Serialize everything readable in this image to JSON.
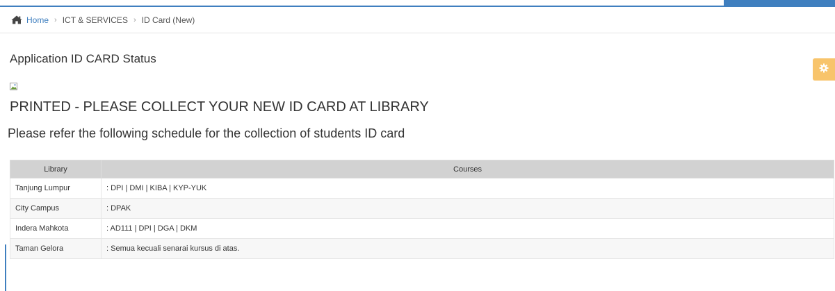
{
  "breadcrumb": {
    "home": "Home",
    "items": [
      "ICT & SERVICES",
      "ID Card (New)"
    ],
    "separator": "›"
  },
  "page": {
    "title": "Application ID CARD Status",
    "status": "PRINTED - PLEASE COLLECT YOUR NEW ID CARD AT LIBRARY",
    "schedule_note": "Please refer the following schedule for the collection of students ID card"
  },
  "table": {
    "headers": [
      "Library",
      "Courses"
    ],
    "rows": [
      {
        "library": "Tanjung Lumpur",
        "courses": ": DPI | DMI | KIBA | KYP-YUK"
      },
      {
        "library": "City Campus",
        "courses": ": DPAK"
      },
      {
        "library": "Indera Mahkota",
        "courses": ": AD111 | DPI | DGA | DKM"
      },
      {
        "library": "Taman Gelora",
        "courses": ": Semua kecuali senarai kursus di atas."
      }
    ]
  },
  "colors": {
    "accent": "#3f7fbf",
    "settings_button": "#f8c46b",
    "table_header": "#d2d2d2"
  },
  "icons": {
    "home": "home-icon",
    "settings": "gear-icon",
    "broken_image": "broken-image-icon"
  }
}
